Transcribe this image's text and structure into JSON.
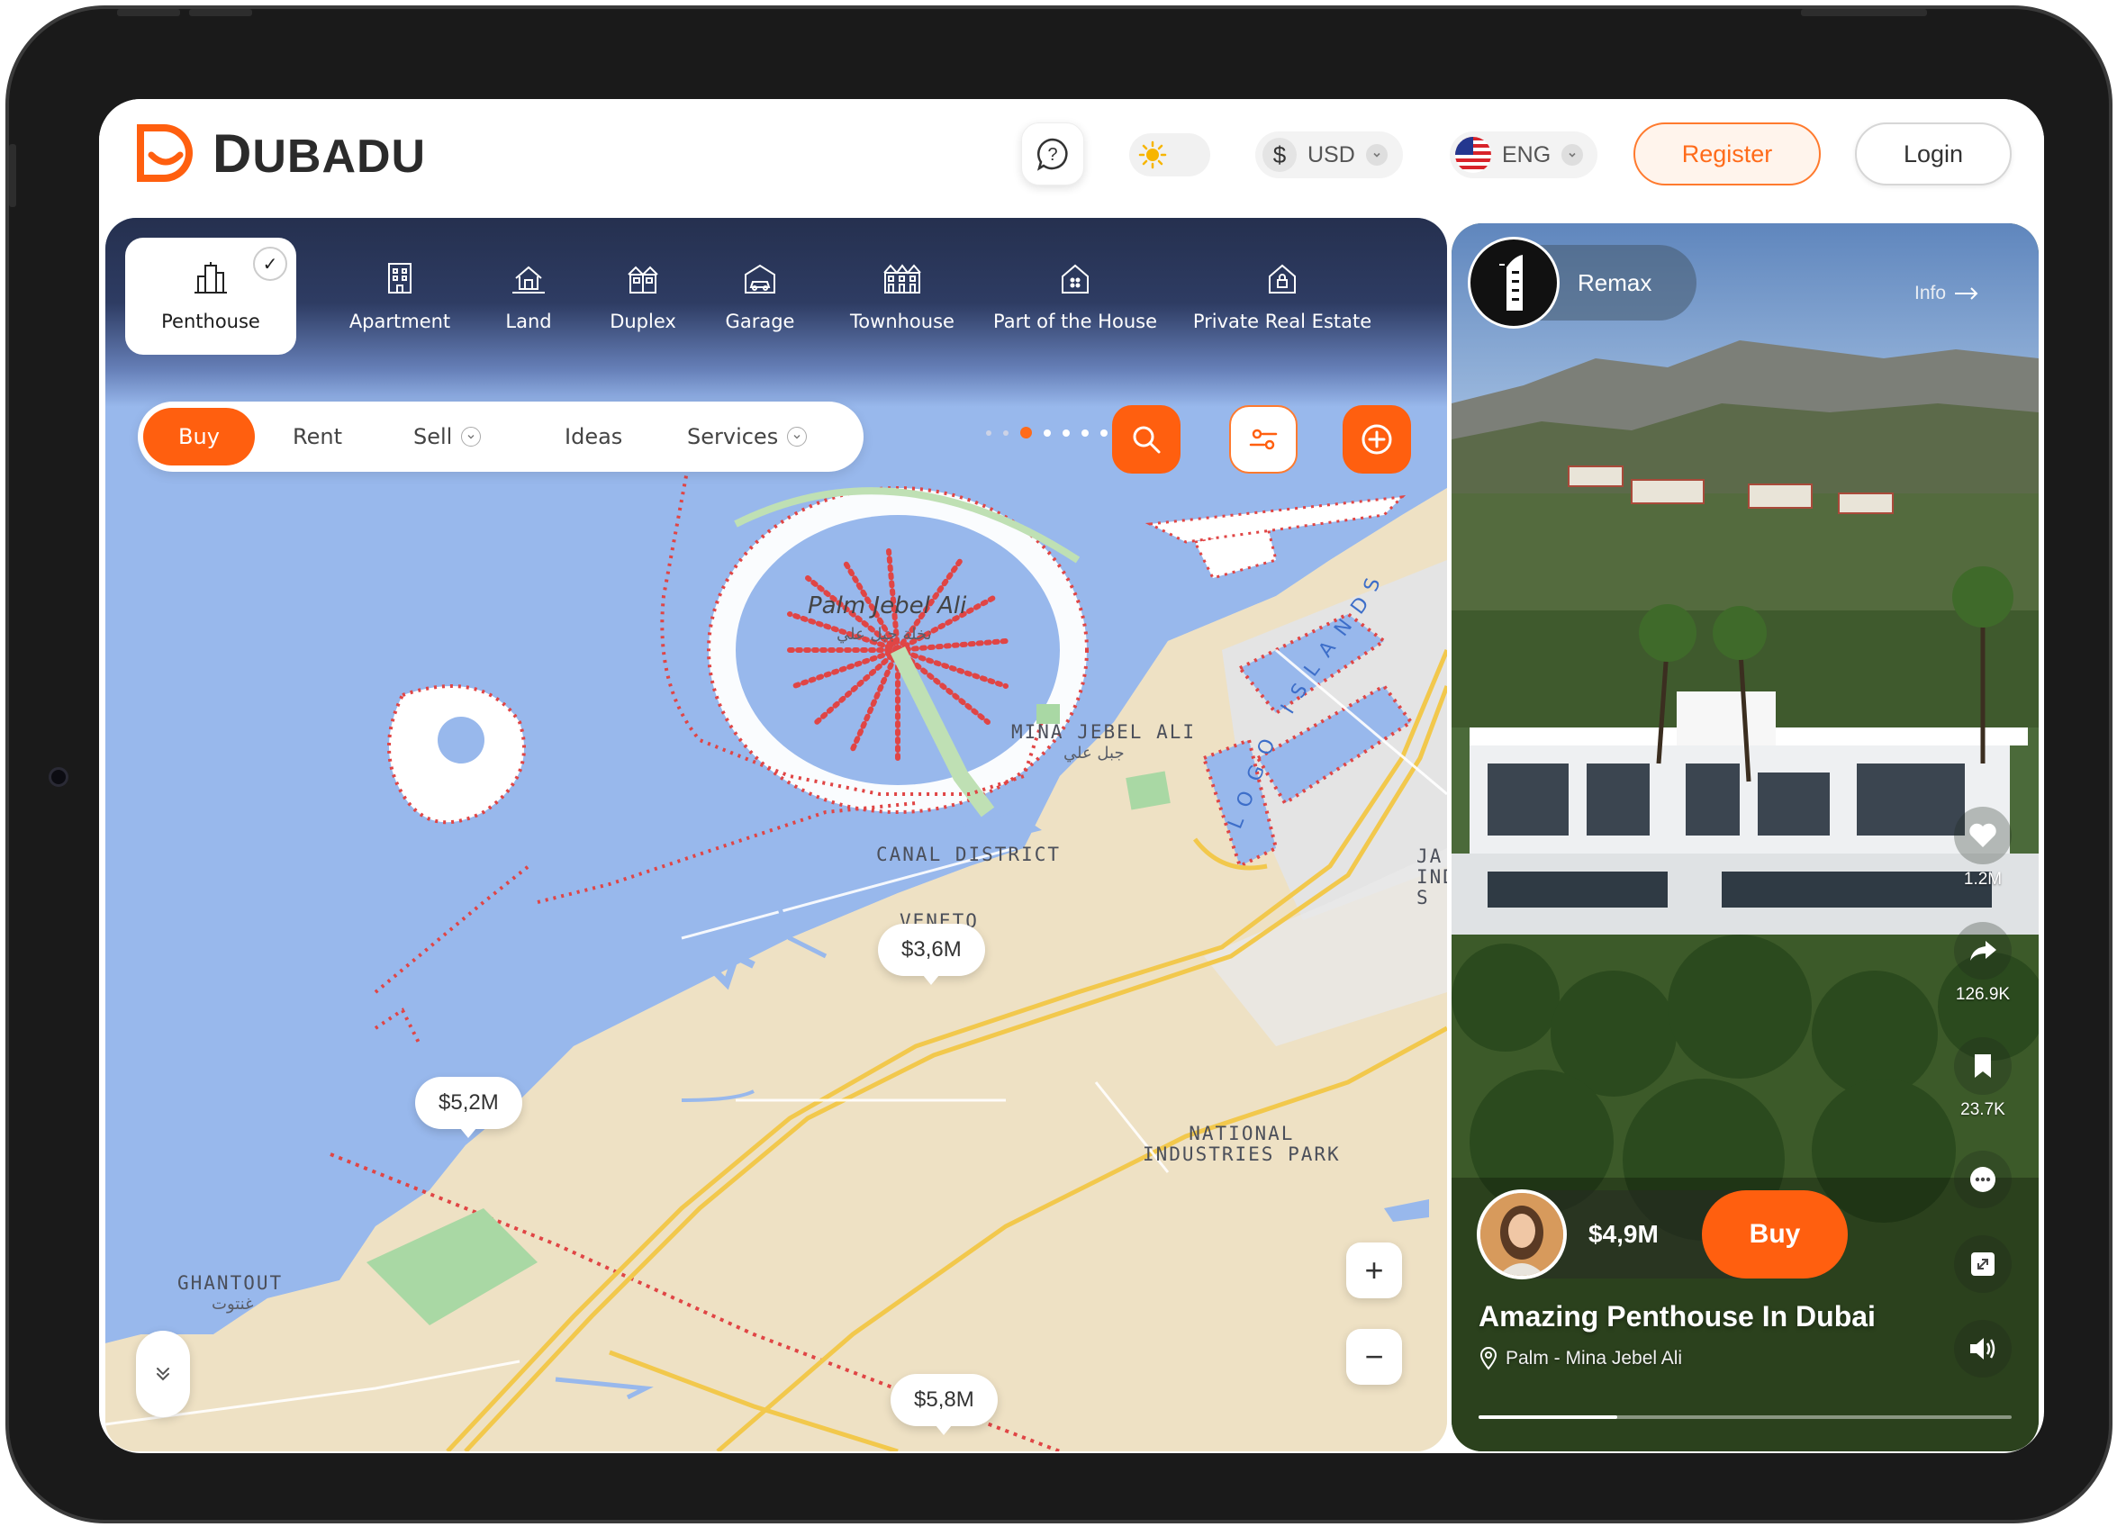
{
  "app": {
    "brand_first": "D",
    "brand_rest": "UBADU",
    "accent": "#ff5f0f"
  },
  "header": {
    "help_icon": "question-bubble-icon",
    "theme_icon": "sun-icon",
    "currency": {
      "symbol": "$",
      "label": "USD"
    },
    "language": {
      "label": "ENG",
      "flag": "us-flag-icon"
    },
    "register_label": "Register",
    "login_label": "Login"
  },
  "categories": {
    "items": [
      {
        "label": "Penthouse",
        "icon": "skyscraper-icon",
        "active": true
      },
      {
        "label": "Apartment",
        "icon": "building-icon"
      },
      {
        "label": "Land",
        "icon": "land-house-icon"
      },
      {
        "label": "Duplex",
        "icon": "duplex-icon"
      },
      {
        "label": "Garage",
        "icon": "garage-icon"
      },
      {
        "label": "Townhouse",
        "icon": "townhouse-icon"
      },
      {
        "label": "Part of the House",
        "icon": "house-part-icon"
      },
      {
        "label": "Private Real Estate",
        "icon": "private-house-icon"
      }
    ],
    "page_count": 10,
    "active_page": 1
  },
  "filter_bar": {
    "buy": "Buy",
    "rent": "Rent",
    "sell": "Sell",
    "ideas": "Ideas",
    "services": "Services"
  },
  "map": {
    "labels": {
      "palm_en": "Palm Jebel Ali",
      "palm_ar": "نخلة جبل علي",
      "mina": "MINA JEBEL ALI",
      "mina_ar": "جبل علي",
      "canal": "CANAL DISTRICT",
      "veneto": "VENETO",
      "national_line1": "NATIONAL",
      "national_line2": "INDUSTRIES PARK",
      "ghantout": "GHANTOUT",
      "ghantout_ar": "غنتوت",
      "logo_islands": "LOGO ISLANDS",
      "jafza_1": "JA",
      "jafza_2": "IND",
      "jafza_3": "S"
    },
    "prices": [
      "$3,6M",
      "$5,2M",
      "$5,8M"
    ],
    "zoom_in": "+",
    "zoom_out": "−"
  },
  "listing": {
    "agency": "Remax",
    "info_label": "Info",
    "likes": "1.2M",
    "shares": "126.9K",
    "saves": "23.7K",
    "price": "$4,9M",
    "buy_label": "Buy",
    "title": "Amazing Penthouse In Dubai",
    "location": "Palm - Mina Jebel Ali",
    "progress": 0.26
  }
}
